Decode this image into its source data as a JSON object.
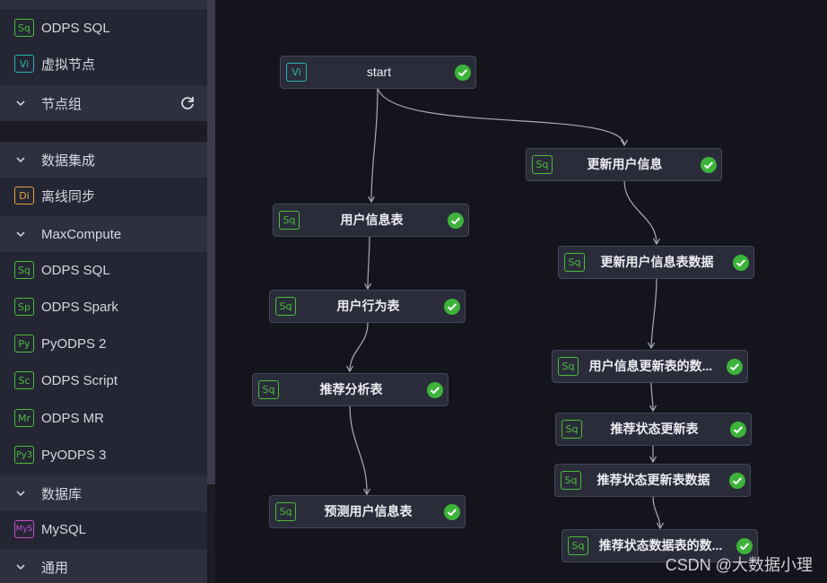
{
  "colors": {
    "sql_icon": "#4cbb3a",
    "virtual_icon": "#2bb5b0",
    "sync_icon": "#e6a23c",
    "mysql_icon": "#c94fc9",
    "success": "#3db33a",
    "edge": "#a9abb8"
  },
  "sidebar": {
    "items": [
      {
        "kind": "item",
        "icon": "Sq",
        "icon_color": "#4cbb3a",
        "label": "ODPS SQL"
      },
      {
        "kind": "item",
        "icon": "Vi",
        "icon_color": "#2bb5b0",
        "label": "虚拟节点"
      },
      {
        "kind": "group",
        "label": "节点组",
        "action_icon": "refresh-icon"
      },
      {
        "kind": "group",
        "label": "数据集成"
      },
      {
        "kind": "item",
        "icon": "Di",
        "icon_color": "#e6a23c",
        "label": "离线同步"
      },
      {
        "kind": "group",
        "label": "MaxCompute"
      },
      {
        "kind": "item",
        "icon": "Sq",
        "icon_color": "#4cbb3a",
        "label": "ODPS SQL"
      },
      {
        "kind": "item",
        "icon": "Sp",
        "icon_color": "#4cbb3a",
        "label": "ODPS Spark"
      },
      {
        "kind": "item",
        "icon": "Py",
        "icon_color": "#4cbb3a",
        "label": "PyODPS 2"
      },
      {
        "kind": "item",
        "icon": "Sc",
        "icon_color": "#4cbb3a",
        "label": "ODPS Script"
      },
      {
        "kind": "item",
        "icon": "Mr",
        "icon_color": "#4cbb3a",
        "label": "ODPS MR"
      },
      {
        "kind": "item",
        "icon": "Py3",
        "icon_color": "#4cbb3a",
        "label": "PyODPS 3"
      },
      {
        "kind": "group",
        "label": "数据库"
      },
      {
        "kind": "item",
        "icon": "MyS",
        "icon_color": "#c94fc9",
        "label": "MySQL"
      },
      {
        "kind": "group",
        "label": "通用"
      }
    ]
  },
  "nodes": [
    {
      "id": "start",
      "icon": "Vi",
      "label": "start",
      "status": "success-icon"
    },
    {
      "id": "user_info",
      "icon": "Sq",
      "label": "用户信息表",
      "status": "success-icon"
    },
    {
      "id": "user_behavior",
      "icon": "Sq",
      "label": "用户行为表",
      "status": "success-icon"
    },
    {
      "id": "rec_analysis",
      "icon": "Sq",
      "label": "推荐分析表",
      "status": "success-icon"
    },
    {
      "id": "predict_user",
      "icon": "Sq",
      "label": "预测用户信息表",
      "status": "success-icon"
    },
    {
      "id": "update_user",
      "icon": "Sq",
      "label": "更新用户信息",
      "status": "success-icon"
    },
    {
      "id": "update_user_data",
      "icon": "Sq",
      "label": "更新用户信息表数据",
      "status": "success-icon"
    },
    {
      "id": "user_update_table",
      "icon": "Sq",
      "label": "用户信息更新表的数...",
      "status": "success-icon"
    },
    {
      "id": "rec_status_update",
      "icon": "Sq",
      "label": "推荐状态更新表",
      "status": "success-icon"
    },
    {
      "id": "rec_status_update_data",
      "icon": "Sq",
      "label": "推荐状态更新表数据",
      "status": "success-icon"
    },
    {
      "id": "rec_status_data_table",
      "icon": "Sq",
      "label": "推荐状态数据表的数...",
      "status": "success-icon"
    }
  ],
  "watermark": "CSDN @大数据小理"
}
